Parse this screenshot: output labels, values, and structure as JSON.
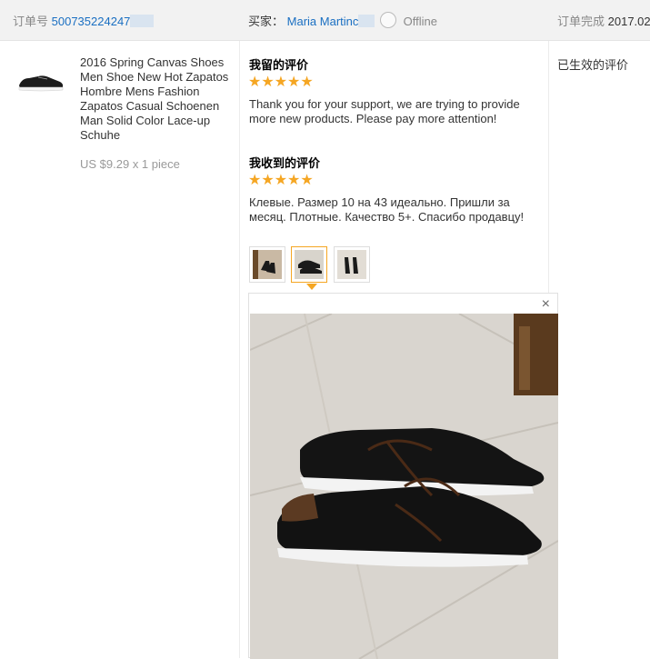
{
  "header": {
    "order_label": "订单号",
    "order_number": "500735224247",
    "buyer_label": "买家：",
    "buyer_name": "Maria Martinc",
    "status": "Offline",
    "completed_label": "订单完成",
    "completed_date": "2017.02"
  },
  "product": {
    "title": "2016 Spring Canvas Shoes Men Shoe New Hot Zapatos Hombre Mens Fashion Zapatos Casual Schoenen Man Solid Color Lace-up Schuhe",
    "price": "US $9.29 x 1 piece"
  },
  "reviews": {
    "my_review_title": "我留的评价",
    "my_review_stars": "★★★★★",
    "my_review_text": "Thank you for your support, we are trying to provide more new products. Please pay more attention!",
    "received_title": "我收到的评价",
    "received_stars": "★★★★★",
    "received_text": "Клевые. Размер 10 на 43 идеально. Пришли за месяц. Плотные. Качество 5+. Спасибо продавцу!",
    "rating": 5,
    "max_rating": 5
  },
  "viewer": {
    "close_glyph": "×",
    "thumbnail_count": 3,
    "active_thumbnail": 2
  },
  "right": {
    "status_text": "已生效的评价"
  },
  "colors": {
    "star": "#f5a623",
    "link": "#1a6fc2",
    "header_bg": "#f2f2f2"
  }
}
